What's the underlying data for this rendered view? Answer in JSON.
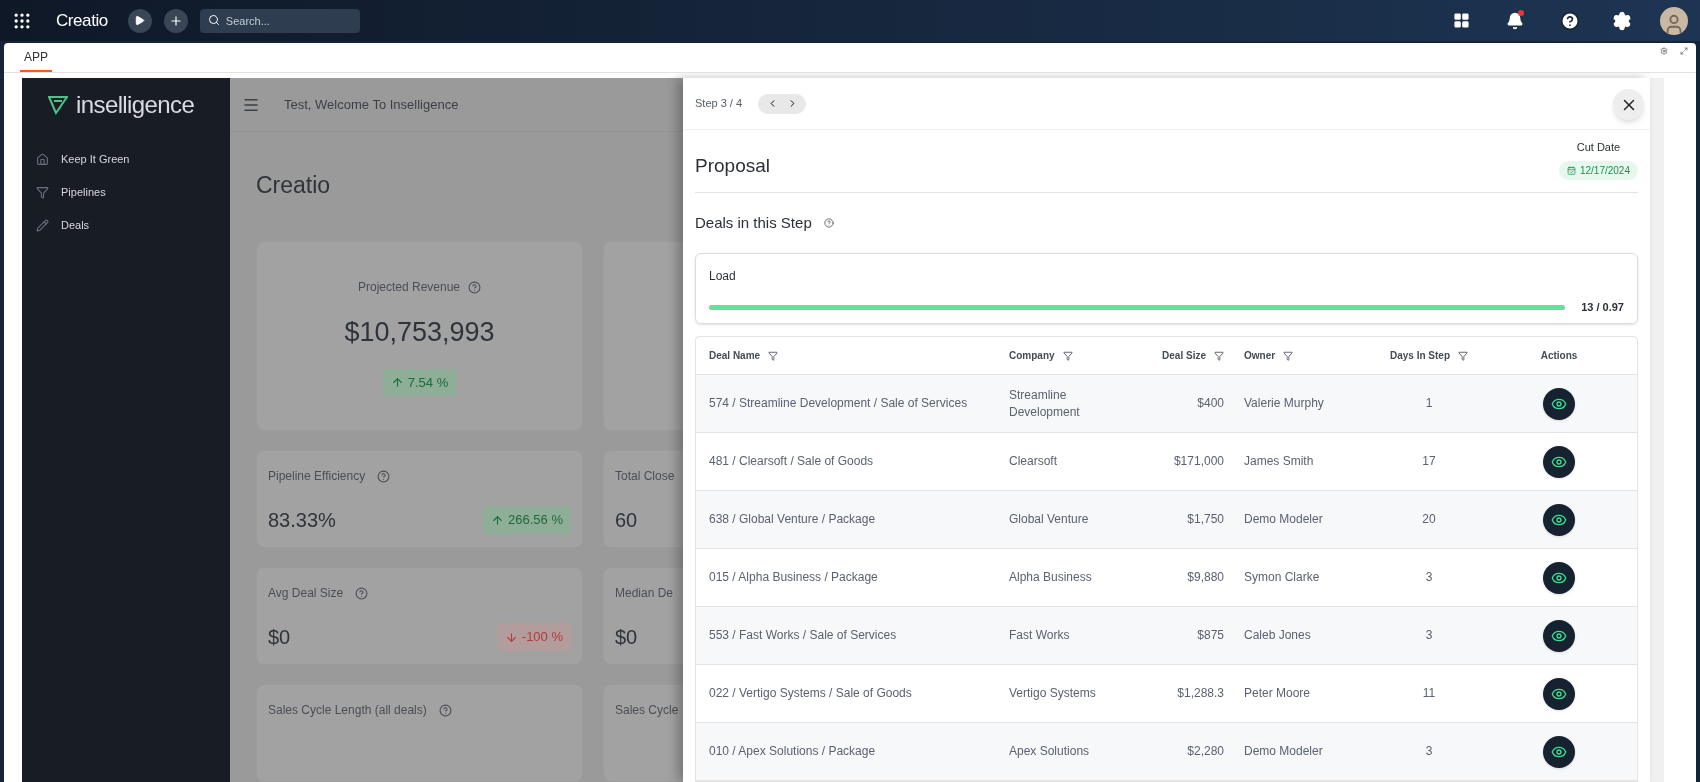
{
  "top_bar": {
    "brand": "Creatio",
    "search": {
      "placeholder": "Search..."
    },
    "has_notification": true
  },
  "tabs": [
    {
      "label": "APP",
      "selected": true
    }
  ],
  "sidebar": {
    "logo": "inselligence",
    "items": [
      {
        "label": "Keep It Green",
        "kind": "home"
      },
      {
        "label": "Pipelines",
        "kind": "funnel"
      },
      {
        "label": "Deals",
        "kind": "pencil"
      }
    ]
  },
  "header": {
    "greeting": "Test, Welcome To Inselligence"
  },
  "page_title": "Creatio",
  "metric_cards": [
    {
      "kind": "hero",
      "label": "Projected Revenue",
      "value": "$10,753,993",
      "change": {
        "text": "7.54 %",
        "kind": "up"
      }
    },
    {
      "kind": "blank"
    },
    {
      "kind": "stat",
      "label": "Pipeline Efficiency",
      "value": "83.33%",
      "change": {
        "text": "266.56 %",
        "kind": "up"
      }
    },
    {
      "kind": "stat",
      "label": "Total Close",
      "value": "60"
    },
    {
      "kind": "stat",
      "label": "Avg Deal Size",
      "value": "$0",
      "change": {
        "text": "-100 %",
        "kind": "down"
      }
    },
    {
      "kind": "stat",
      "label": "Median De",
      "value": "$0"
    },
    {
      "kind": "stat",
      "label": "Sales Cycle Length (all deals)"
    },
    {
      "kind": "stat",
      "label": "Sales Cycle"
    }
  ],
  "drawer": {
    "step": "Step 3 / 4",
    "title": "Proposal",
    "cut_date": {
      "label": "Cut Date",
      "value": "12/17/2024"
    },
    "section_title": "Deals in this Step",
    "load": {
      "label": "Load",
      "level": 1,
      "reading": "13 / 0.97"
    },
    "table": {
      "columns": [
        {
          "label": "Deal Name",
          "filterable": true
        },
        {
          "label": "Company",
          "filterable": true
        },
        {
          "label": "Deal Size",
          "filterable": true
        },
        {
          "label": "Owner",
          "filterable": true
        },
        {
          "label": "Days In Step",
          "filterable": true
        },
        {
          "label": "Actions",
          "filterable": false
        }
      ],
      "rows": [
        [
          "574 / Streamline Development / Sale of Services",
          "Streamline Development",
          "$400",
          "Valerie Murphy",
          "1"
        ],
        [
          "481 / Clearsoft / Sale of Goods",
          "Clearsoft",
          "$171,000",
          "James Smith",
          "17"
        ],
        [
          "638 / Global Venture / Package",
          "Global Venture",
          "$1,750",
          "Demo Modeler",
          "20"
        ],
        [
          "015 / Alpha Business / Package",
          "Alpha Business",
          "$9,880",
          "Symon Clarke",
          "3"
        ],
        [
          "553 / Fast Works / Sale of Services",
          "Fast Works",
          "$875",
          "Caleb Jones",
          "3"
        ],
        [
          "022 / Vertigo Systems / Sale of Goods",
          "Vertigo Systems",
          "$1,288.3",
          "Peter Moore",
          "11"
        ],
        [
          "010 / Apex Solutions / Package",
          "Apex Solutions",
          "$2,280",
          "Demo Modeler",
          "3"
        ]
      ]
    }
  }
}
